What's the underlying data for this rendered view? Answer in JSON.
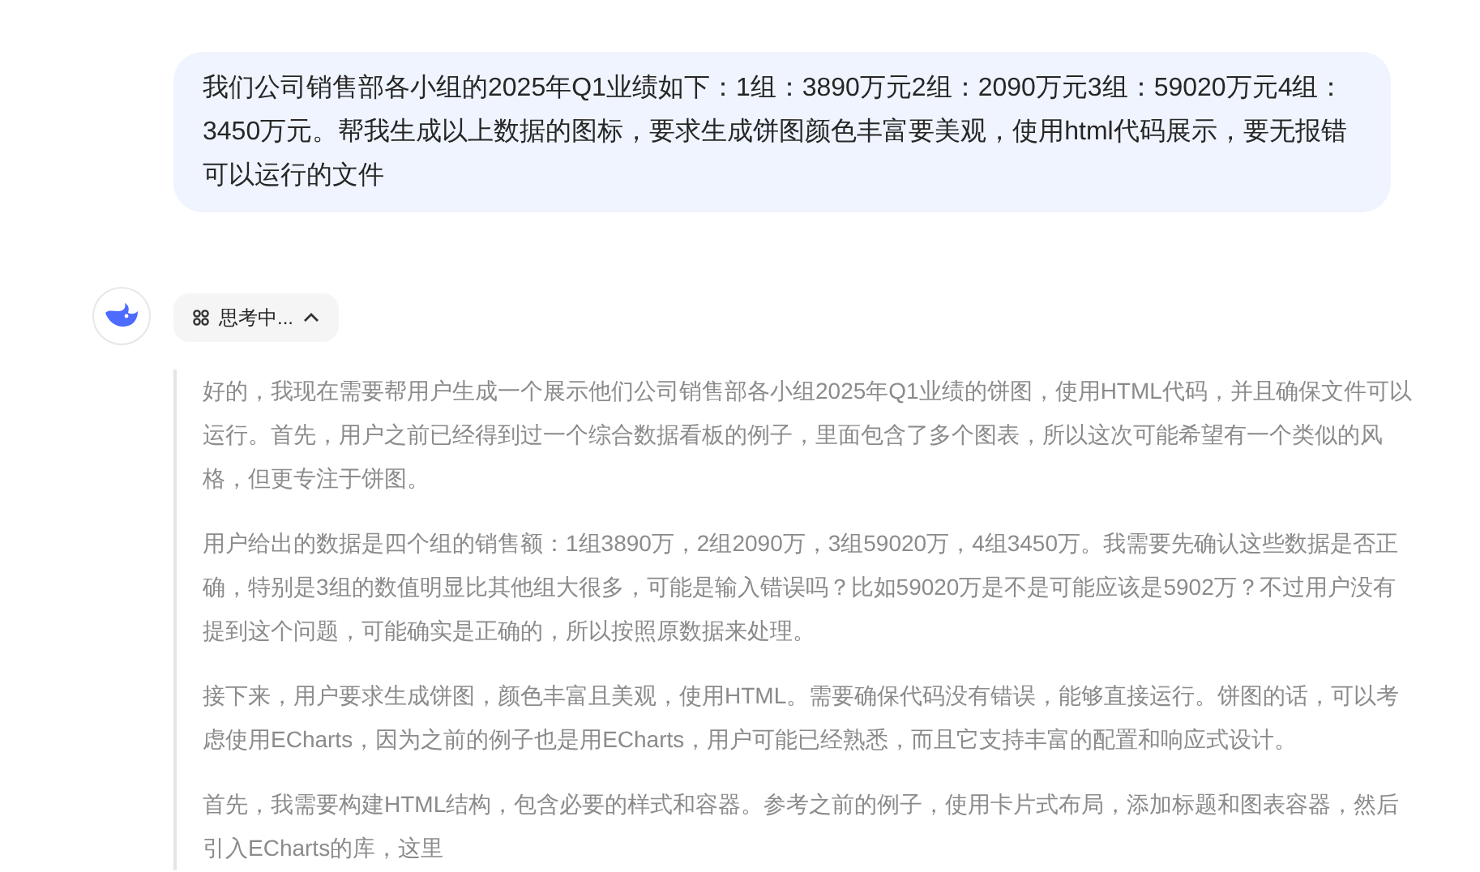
{
  "user_message": "我们公司销售部各小组的2025年Q1业绩如下：1组：3890万元2组：2090万元3组：59020万元4组：3450万元。帮我生成以上数据的图标，要求生成饼图颜色丰富要美观，使用html代码展示，要无报错可以运行的文件",
  "thinking_toggle": {
    "label": "思考中...",
    "expanded": true
  },
  "reasoning": [
    "好的，我现在需要帮用户生成一个展示他们公司销售部各小组2025年Q1业绩的饼图，使用HTML代码，并且确保文件可以运行。首先，用户之前已经得到过一个综合数据看板的例子，里面包含了多个图表，所以这次可能希望有一个类似的风格，但更专注于饼图。",
    "用户给出的数据是四个组的销售额：1组3890万，2组2090万，3组59020万，4组3450万。我需要先确认这些数据是否正确，特别是3组的数值明显比其他组大很多，可能是输入错误吗？比如59020万是不是可能应该是5902万？不过用户没有提到这个问题，可能确实是正确的，所以按照原数据来处理。",
    "接下来，用户要求生成饼图，颜色丰富且美观，使用HTML。需要确保代码没有错误，能够直接运行。饼图的话，可以考虑使用ECharts，因为之前的例子也是用ECharts，用户可能已经熟悉，而且它支持丰富的配置和响应式设计。",
    "首先，我需要构建HTML结构，包含必要的样式和容器。参考之前的例子，使用卡片式布局，添加标题和图表容器，然后引入ECharts的库，这里"
  ]
}
